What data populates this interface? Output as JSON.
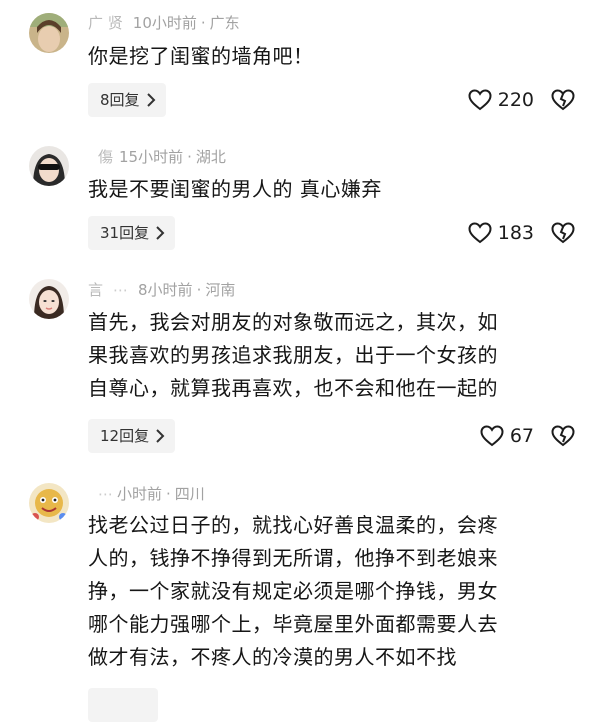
{
  "comments": [
    {
      "username": "广 贤",
      "time": "10小时前",
      "location": "广东",
      "lines": [
        "你是挖了闺蜜的墙角吧！"
      ],
      "replies": "8回复",
      "likes": "220"
    },
    {
      "username": "",
      "time": "15小时前",
      "location": "湖北",
      "lines": [
        "我是不要闺蜜的男人的 真心嫌弃"
      ],
      "replies": "31回复",
      "likes": "183"
    },
    {
      "username": "言",
      "time": "8小时前",
      "location": "河南",
      "lines": [
        "首先，我会对朋友的对象敬而远之，其次，如",
        "果我喜欢的男孩追求我朋友，出于一个女孩的",
        "自尊心，就算我再喜欢，也不会和他在一起的"
      ],
      "replies": "12回复",
      "likes": "67"
    },
    {
      "username": "",
      "time": "小时前",
      "location": "四川",
      "lines": [
        "找老公过日子的，就找心好善良温柔的，会疼",
        "人的，钱挣不挣得到无所谓，他挣不到老娘来",
        "挣，一个家就没有规定必须是哪个挣钱，男女",
        "哪个能力强哪个上，毕竟屋里外面都需要人去",
        "做才有法，不疼人的冷漠的男人不如不找"
      ]
    }
  ],
  "icons": {
    "like": "heart-outline-icon",
    "dislike": "broken-heart-icon",
    "chevron": "chevron-right-icon"
  }
}
